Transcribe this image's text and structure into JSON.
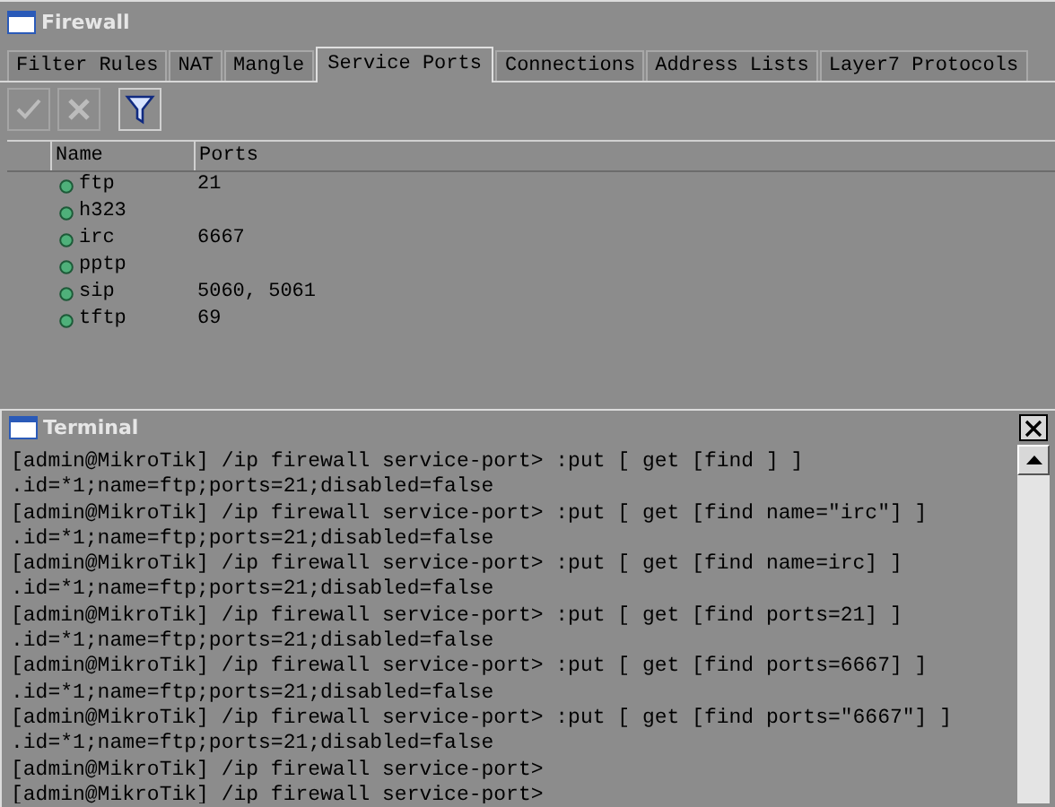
{
  "firewall_window": {
    "title": "Firewall",
    "tabs": [
      {
        "label": "Filter Rules",
        "selected": false
      },
      {
        "label": "NAT",
        "selected": false
      },
      {
        "label": "Mangle",
        "selected": false
      },
      {
        "label": "Service Ports",
        "selected": true
      },
      {
        "label": "Connections",
        "selected": false
      },
      {
        "label": "Address Lists",
        "selected": false
      },
      {
        "label": "Layer7 Protocols",
        "selected": false
      }
    ],
    "toolbar": [
      {
        "kind": "enable",
        "disabled": true
      },
      {
        "kind": "disable",
        "disabled": true
      },
      {
        "kind": "filter",
        "disabled": false
      }
    ],
    "table": {
      "columns": [
        "Name",
        "Ports"
      ],
      "rows": [
        {
          "name": "ftp",
          "ports": "21"
        },
        {
          "name": "h323",
          "ports": ""
        },
        {
          "name": "irc",
          "ports": "6667"
        },
        {
          "name": "pptp",
          "ports": ""
        },
        {
          "name": "sip",
          "ports": "5060, 5061"
        },
        {
          "name": "tftp",
          "ports": "69"
        }
      ]
    }
  },
  "terminal_window": {
    "title": "Terminal",
    "lines": [
      "[admin@MikroTik] /ip firewall service-port> :put [ get [find ] ]",
      ".id=*1;name=ftp;ports=21;disabled=false",
      "[admin@MikroTik] /ip firewall service-port> :put [ get [find name=\"irc\"] ]",
      ".id=*1;name=ftp;ports=21;disabled=false",
      "[admin@MikroTik] /ip firewall service-port> :put [ get [find name=irc] ]",
      ".id=*1;name=ftp;ports=21;disabled=false",
      "[admin@MikroTik] /ip firewall service-port> :put [ get [find ports=21] ]",
      ".id=*1;name=ftp;ports=21;disabled=false",
      "[admin@MikroTik] /ip firewall service-port> :put [ get [find ports=6667] ]",
      ".id=*1;name=ftp;ports=21;disabled=false",
      "[admin@MikroTik] /ip firewall service-port> :put [ get [find ports=\"6667\"] ]",
      ".id=*1;name=ftp;ports=21;disabled=false",
      "[admin@MikroTik] /ip firewall service-port>",
      "[admin@MikroTik] /ip firewall service-port>"
    ]
  }
}
